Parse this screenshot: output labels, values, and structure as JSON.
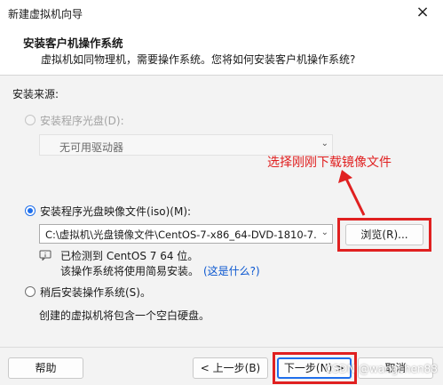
{
  "window": {
    "title": "新建虚拟机向导",
    "close_glyph": "×"
  },
  "header": {
    "title": "安装客户机操作系统",
    "description": "虚拟机如同物理机，需要操作系统。您将如何安装客户机操作系统?"
  },
  "install_source": {
    "label": "安装来源:",
    "disc": {
      "label": "安装程序光盘(D):",
      "selected": false,
      "enabled": false,
      "drive_value": "无可用驱动器"
    },
    "iso": {
      "label": "安装程序光盘映像文件(iso)(M):",
      "selected": true,
      "path_value": "C:\\虚拟机\\光盘镜像文件\\CentOS-7-x86_64-DVD-1810-7.(",
      "browse_label": "浏览(R)...",
      "detected_line": "已检测到 CentOS 7 64 位。",
      "easy_install_text": "该操作系统将使用简易安装。",
      "what_is_this_link": "(这是什么?)"
    },
    "later": {
      "label": "稍后安装操作系统(S)。",
      "selected": false,
      "description": "创建的虚拟机将包含一个空白硬盘。"
    }
  },
  "annotation": {
    "text": "选择刚刚下载镜像文件",
    "color": "#e02020"
  },
  "footer": {
    "help_label": "帮助",
    "back_label": "< 上一步(B)",
    "next_label": "下一步(N) >",
    "cancel_label": "取消"
  },
  "watermark": "CSDN @wangchen88",
  "colors": {
    "accent": "#1f6feb",
    "annotation_red": "#e02020",
    "link": "#0b57d0"
  }
}
